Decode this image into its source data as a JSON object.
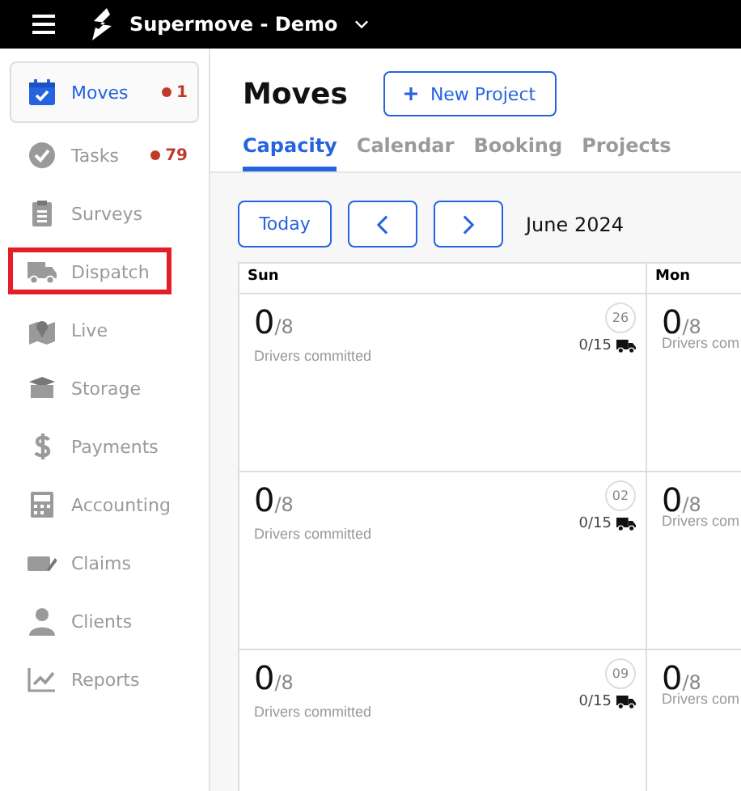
{
  "top_bar": {
    "title": "Supermove - Demo"
  },
  "sidebar": {
    "items": [
      {
        "label": "Moves",
        "selected": true,
        "highlighted": false,
        "badge": "1"
      },
      {
        "label": "Tasks",
        "selected": false,
        "highlighted": false,
        "badge": "79"
      },
      {
        "label": "Surveys",
        "selected": false,
        "highlighted": false
      },
      {
        "label": "Dispatch",
        "selected": false,
        "highlighted": true
      },
      {
        "label": "Live",
        "selected": false,
        "highlighted": false
      },
      {
        "label": "Storage",
        "selected": false,
        "highlighted": false
      },
      {
        "label": "Payments",
        "selected": false,
        "highlighted": false
      },
      {
        "label": "Accounting",
        "selected": false,
        "highlighted": false
      },
      {
        "label": "Claims",
        "selected": false,
        "highlighted": false
      },
      {
        "label": "Clients",
        "selected": false,
        "highlighted": false
      },
      {
        "label": "Reports",
        "selected": false,
        "highlighted": false
      }
    ]
  },
  "page": {
    "title": "Moves",
    "new_button": "New Project",
    "tabs": [
      {
        "label": "Capacity",
        "selected": true
      },
      {
        "label": "Calendar",
        "selected": false
      },
      {
        "label": "Booking",
        "selected": false
      },
      {
        "label": "Projects",
        "selected": false
      }
    ]
  },
  "toolbar": {
    "today": "Today",
    "month": "June 2024"
  },
  "calendar": {
    "columns": [
      "Sun",
      "Mon"
    ],
    "weeks": [
      {
        "cells": [
          {
            "committed": "0",
            "total": "/8",
            "caption": "Drivers committed",
            "date": "26",
            "trucks": "0/15"
          },
          {
            "committed": "0",
            "total": "/8",
            "caption": "Drivers com"
          }
        ]
      },
      {
        "cells": [
          {
            "committed": "0",
            "total": "/8",
            "caption": "Drivers committed",
            "date": "02",
            "trucks": "0/15"
          },
          {
            "committed": "0",
            "total": "/8",
            "caption": "Drivers com"
          }
        ]
      },
      {
        "cells": [
          {
            "committed": "0",
            "total": "/8",
            "caption": "Drivers committed",
            "date": "09",
            "trucks": "0/15"
          },
          {
            "committed": "0",
            "total": "/8",
            "caption": "Drivers com"
          }
        ]
      }
    ]
  }
}
